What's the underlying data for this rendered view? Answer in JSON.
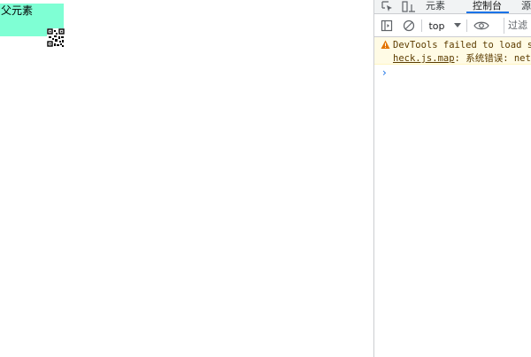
{
  "page": {
    "parent_label": "父元素"
  },
  "devtools": {
    "tabs": [
      {
        "label": "元素"
      },
      {
        "label": "控制台"
      },
      {
        "label": "源"
      }
    ],
    "toolbar": {
      "context_value": "top",
      "filter_placeholder": "过滤"
    },
    "messages": [
      {
        "level": "warning",
        "line1": "DevTools failed to load so",
        "link": "heck.js.map",
        "line2_rest": ": 系统错误: net"
      }
    ],
    "prompt_symbol": "›"
  },
  "colors": {
    "parent_bg": "#7fffd4",
    "accent": "#1a73e8",
    "warning_bg": "#fffbe5",
    "warning_text": "#5c3c00"
  }
}
